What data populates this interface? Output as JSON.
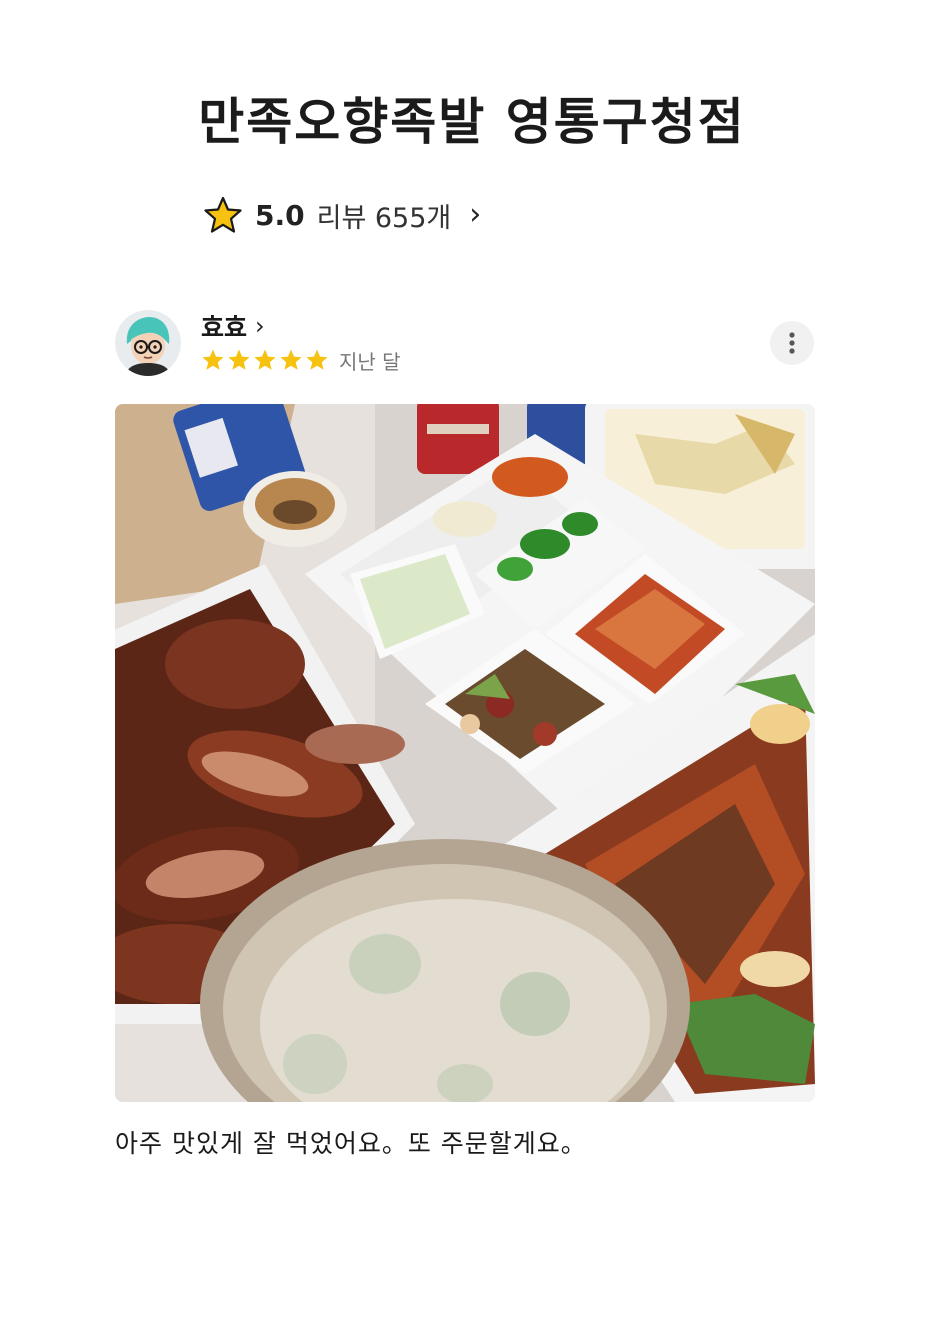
{
  "store": {
    "name": "만족오향족발 영통구청점",
    "rating": "5.0",
    "review_count_label": "리뷰 655개"
  },
  "review": {
    "author": "효효",
    "stars": 5,
    "date": "지난 달",
    "text": "아주 맛있게 잘 먹었어요。또 주문할게요。"
  },
  "icons": {
    "rating": "star-icon",
    "more": "more-vertical-icon",
    "chevron": "chevron-right-icon"
  },
  "colors": {
    "star": "#F6C20F",
    "star_outline": "#1a1a1a",
    "more_bg": "#F1F1F1",
    "avatar_hair": "#49C4B8"
  }
}
